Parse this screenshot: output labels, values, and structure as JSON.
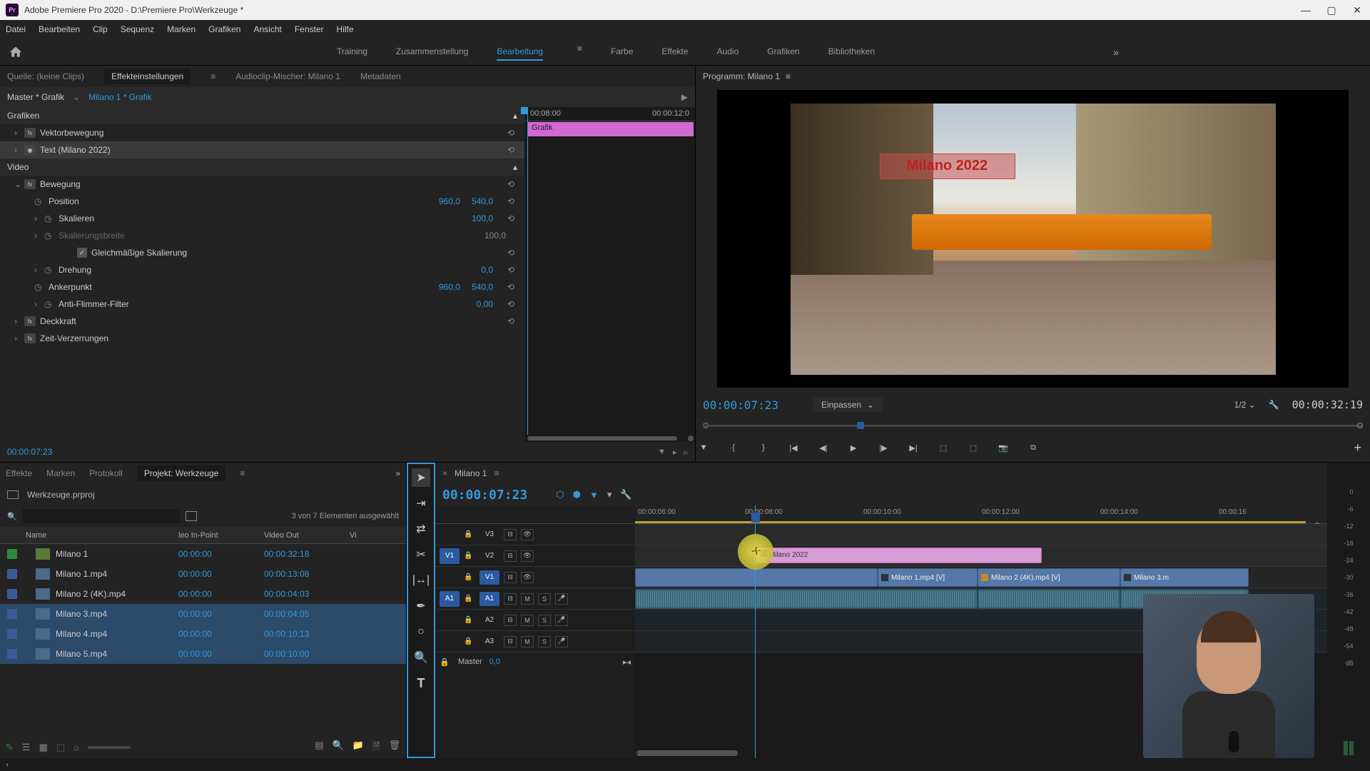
{
  "title_bar": {
    "app_icon": "Pr",
    "title": "Adobe Premiere Pro 2020 - D:\\Premiere Pro\\Werkzeuge *"
  },
  "menu": [
    "Datei",
    "Bearbeiten",
    "Clip",
    "Sequenz",
    "Marken",
    "Grafiken",
    "Ansicht",
    "Fenster",
    "Hilfe"
  ],
  "workspaces": {
    "items": [
      "Training",
      "Zusammenstellung",
      "Bearbeitung",
      "Farbe",
      "Effekte",
      "Audio",
      "Grafiken",
      "Bibliotheken"
    ],
    "active_index": 2
  },
  "source_tabs": {
    "items": [
      "Quelle: (keine Clips)",
      "Effekteinstellungen",
      "Audioclip-Mischer: Milano 1",
      "Metadaten"
    ],
    "active_index": 1
  },
  "effect_controls": {
    "master": "Master * Grafik",
    "clip": "Milano 1 * Grafik",
    "timeline_start": "00:08:00",
    "timeline_end": "00:00:12:0",
    "timeline_clip_label": "Grafik",
    "groups": {
      "grafiken": "Grafiken",
      "vektorbewegung": "Vektorbewegung",
      "text_item": "Text (Milano 2022)",
      "video": "Video",
      "bewegung": "Bewegung",
      "position": "Position",
      "position_x": "960,0",
      "position_y": "540,0",
      "skalieren": "Skalieren",
      "skalieren_val": "100,0",
      "skalierungsbreite": "Skalierungsbreite",
      "skalierungsbreite_val": "100,0",
      "gleichmaessig": "Gleichmäßige Skalierung",
      "drehung": "Drehung",
      "drehung_val": "0,0",
      "ankerpunkt": "Ankerpunkt",
      "anker_x": "960,0",
      "anker_y": "540,0",
      "antiflimmer": "Anti-Flimmer-Filter",
      "antiflimmer_val": "0,00",
      "deckkraft": "Deckkraft",
      "zeitverzerrungen": "Zeit-Verzerrungen"
    },
    "current_time": "00:00:07:23"
  },
  "program": {
    "label": "Programm: Milano 1",
    "overlay_text": "Milano 2022",
    "time": "00:00:07:23",
    "fit": "Einpassen",
    "zoom": "1/2",
    "duration": "00:00:32:19"
  },
  "project": {
    "tabs": [
      "Effekte",
      "Marken",
      "Protokoll",
      "Projekt: Werkzeuge"
    ],
    "active_tab_index": 3,
    "file": "Werkzeuge.prproj",
    "selection": "3 von 7 Elementen ausgewählt",
    "columns": [
      "Name",
      "leo In-Point",
      "Video Out",
      "Vi"
    ],
    "rows": [
      {
        "label": "green",
        "type": "seq",
        "name": "Milano 1",
        "in": "00:00:00",
        "out": "00:00:32:18",
        "selected": false
      },
      {
        "label": "blue",
        "type": "vid",
        "name": "Milano 1.mp4",
        "in": "00:00:00",
        "out": "00:00:13:08",
        "selected": false
      },
      {
        "label": "blue",
        "type": "vid",
        "name": "Milano 2 (4K).mp4",
        "in": "00:00:00",
        "out": "00:00:04:03",
        "selected": false
      },
      {
        "label": "blue",
        "type": "vid",
        "name": "Milano 3.mp4",
        "in": "00:00:00",
        "out": "00:00:04:05",
        "selected": true
      },
      {
        "label": "blue",
        "type": "vid",
        "name": "Milano 4.mp4",
        "in": "00:00:00",
        "out": "00:00:10:13",
        "selected": true
      },
      {
        "label": "blue",
        "type": "vid",
        "name": "Milano 5.mp4",
        "in": "00:00:00",
        "out": "00:00:10:00",
        "selected": true
      }
    ]
  },
  "timeline": {
    "sequence_name": "Milano 1",
    "time": "00:00:07:23",
    "ruler": [
      "00:00:06:00",
      "00:00:08:00",
      "00:00:10:00",
      "00:00:12:00",
      "00:00:14:00",
      "00:00:16"
    ],
    "tracks": {
      "v3": "V3",
      "v2": "V2",
      "v1": "V1",
      "a1": "A1",
      "a2": "A2",
      "a3": "A3",
      "src_v1": "V1",
      "src_a1": "A1",
      "master": "Master",
      "master_vol": "0,0",
      "mute": "M",
      "solo": "S"
    },
    "clips": {
      "gfx": "Milano 2022",
      "vid1": "Milano 1.mp4 [V]",
      "vid2": "Milano 2 (4K).mp4 [V]",
      "vid3": "Milano 3.m"
    }
  },
  "meters": {
    "scale": [
      "0",
      "-6",
      "-12",
      "-18",
      "-24",
      "-30",
      "-36",
      "-42",
      "-48",
      "-54",
      "dB"
    ]
  }
}
